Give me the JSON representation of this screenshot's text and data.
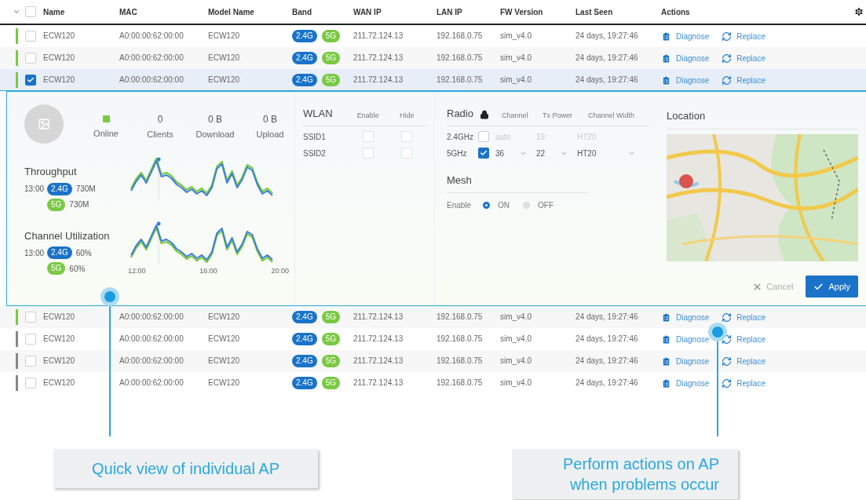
{
  "table": {
    "header_checked": false,
    "columns": [
      "Name",
      "MAC",
      "Model Name",
      "Band",
      "WAN IP",
      "LAN IP",
      "FW Version",
      "Last Seen",
      "Actions"
    ],
    "rows": [
      {
        "color": "#7ac943",
        "checked": false,
        "expanded": false,
        "name": "ECW120",
        "mac": "A0:00:00:62:00:00",
        "model": "ECW120",
        "bands": [
          {
            "label": "2.4G",
            "color": "#1a73c8"
          },
          {
            "label": "5G",
            "color": "#7ac943"
          }
        ],
        "wan_ip": "211.72.124.13",
        "lan_ip": "192.168.0.75",
        "fw": "sim_v4.0",
        "last_seen": "24 days, 19:27:46",
        "actions": [
          {
            "kind": "diagnose",
            "label": "Diagnose"
          },
          {
            "kind": "replace",
            "label": "Replace"
          }
        ]
      },
      {
        "color": "#7ac943",
        "checked": false,
        "expanded": false,
        "name": "ECW120",
        "mac": "A0:00:00:62:00:00",
        "model": "ECW120",
        "bands": [
          {
            "label": "2.4G",
            "color": "#1a73c8"
          },
          {
            "label": "5G",
            "color": "#7ac943"
          }
        ],
        "wan_ip": "211.72.124.13",
        "lan_ip": "192.168.0.75",
        "fw": "sim_v4.0",
        "last_seen": "24 days, 19:27:46",
        "actions": [
          {
            "kind": "diagnose",
            "label": "Diagnose"
          },
          {
            "kind": "replace",
            "label": "Replace"
          }
        ]
      },
      {
        "color": "#7ac943",
        "checked": true,
        "expanded": true,
        "name": "ECW120",
        "mac": "A0:00:00:62:00:00",
        "model": "ECW120",
        "bands": [
          {
            "label": "2.4G",
            "color": "#1a73c8"
          },
          {
            "label": "5G",
            "color": "#7ac943"
          }
        ],
        "wan_ip": "211.72.124.13",
        "lan_ip": "192.168.0.75",
        "fw": "sim_v4.0",
        "last_seen": "24 days, 19:27:46",
        "actions": [
          {
            "kind": "diagnose",
            "label": "Diagnose"
          },
          {
            "kind": "replace",
            "label": "Replace"
          }
        ]
      },
      {
        "color": "#7ac943",
        "checked": false,
        "expanded": false,
        "name": "ECW120",
        "mac": "A0:00:00:62:00:00",
        "model": "ECW120",
        "bands": [
          {
            "label": "2.4G",
            "color": "#1a73c8"
          },
          {
            "label": "5G",
            "color": "#7ac943"
          }
        ],
        "wan_ip": "211.72.124.13",
        "lan_ip": "192.168.0.75",
        "fw": "sim_v4.0",
        "last_seen": "24 days, 19:27:46",
        "actions": [
          {
            "kind": "diagnose",
            "label": "Diagnose"
          },
          {
            "kind": "replace",
            "label": "Replace"
          }
        ]
      },
      {
        "color": "#888888",
        "checked": false,
        "expanded": false,
        "name": "ECW120",
        "mac": "A0:00:00:62:00:00",
        "model": "ECW120",
        "bands": [
          {
            "label": "2.4G",
            "color": "#1a73c8"
          },
          {
            "label": "5G",
            "color": "#7ac943"
          }
        ],
        "wan_ip": "211.72.124.13",
        "lan_ip": "192.168.0.75",
        "fw": "sim_v4.0",
        "last_seen": "24 days, 19:27:46",
        "actions": [
          {
            "kind": "diagnose",
            "label": "Diagnose"
          },
          {
            "kind": "replace",
            "label": "Replace"
          }
        ]
      },
      {
        "color": "#888888",
        "checked": false,
        "expanded": false,
        "name": "ECW120",
        "mac": "A0:00:00:62:00:00",
        "model": "ECW120",
        "bands": [
          {
            "label": "2.4G",
            "color": "#1a73c8"
          },
          {
            "label": "5G",
            "color": "#7ac943"
          }
        ],
        "wan_ip": "211.72.124.13",
        "lan_ip": "192.168.0.75",
        "fw": "sim_v4.0",
        "last_seen": "24 days, 19:27:46",
        "actions": [
          {
            "kind": "diagnose",
            "label": "Diagnose"
          },
          {
            "kind": "replace",
            "label": "Replace"
          }
        ]
      },
      {
        "color": "#888888",
        "checked": false,
        "expanded": false,
        "name": "ECW120",
        "mac": "A0:00:00:62:00:00",
        "model": "ECW120",
        "bands": [
          {
            "label": "2.4G",
            "color": "#1a73c8"
          },
          {
            "label": "5G",
            "color": "#7ac943"
          }
        ],
        "wan_ip": "211.72.124.13",
        "lan_ip": "192.168.0.75",
        "fw": "sim_v4.0",
        "last_seen": "24 days, 19:27:46",
        "actions": [
          {
            "kind": "diagnose",
            "label": "Diagnose"
          },
          {
            "kind": "replace",
            "label": "Replace"
          }
        ]
      }
    ]
  },
  "detail": {
    "status": {
      "label": "Online",
      "color": "#7ac943"
    },
    "stats": [
      {
        "value": "0",
        "label": "Clients"
      },
      {
        "value": "0 B",
        "label": "Download"
      },
      {
        "value": "0 B",
        "label": "Upload"
      }
    ],
    "charts": [
      {
        "title": "Throughput",
        "time": "13:00",
        "bands": [
          {
            "label": "2.4G",
            "color": "#1a73c8",
            "value": "730M"
          },
          {
            "label": "5G",
            "color": "#7ac943",
            "value": "730M"
          }
        ]
      },
      {
        "title": "Channel Utilization",
        "time": "13:00",
        "bands": [
          {
            "label": "2.4G",
            "color": "#1a73c8",
            "value": "60%"
          },
          {
            "label": "5G",
            "color": "#7ac943",
            "value": "60%"
          }
        ],
        "x_ticks": [
          "12:00",
          "16:00",
          "20:00"
        ]
      }
    ],
    "wlan": {
      "headers": [
        "WLAN",
        "Enable",
        "Hide"
      ],
      "ssids": [
        {
          "name": "SSID1",
          "enable": false,
          "hide": false
        },
        {
          "name": "SSID2",
          "enable": false,
          "hide": false
        }
      ]
    },
    "radio": {
      "title": "Radio",
      "headers": [
        "Channel",
        "Tx Power",
        "Channel Width"
      ],
      "bands": [
        {
          "name": "2.4GHz",
          "enabled": false,
          "channel": "auto",
          "tx_power": "19",
          "width": "HT20"
        },
        {
          "name": "5GHz",
          "enabled": true,
          "channel": "36",
          "tx_power": "22",
          "width": "HT20"
        }
      ]
    },
    "mesh": {
      "title": "Mesh",
      "label": "Enable",
      "options": [
        {
          "label": "ON",
          "selected": true
        },
        {
          "label": "OFF",
          "selected": false
        }
      ]
    },
    "location": {
      "title": "Location"
    },
    "buttons": [
      {
        "kind": "cancel",
        "label": "Cancel"
      },
      {
        "kind": "apply",
        "label": "Apply"
      }
    ]
  },
  "callouts": [
    {
      "text": "Quick view of individual AP"
    },
    {
      "text": "Perform actions on AP when problems occur"
    }
  ]
}
